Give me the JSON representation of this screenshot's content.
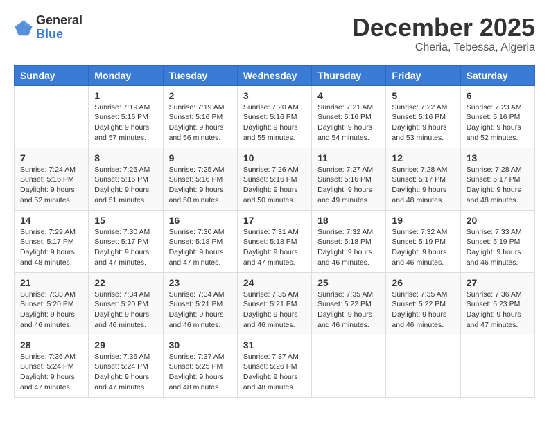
{
  "header": {
    "logo_general": "General",
    "logo_blue": "Blue",
    "month_title": "December 2025",
    "subtitle": "Cheria, Tebessa, Algeria"
  },
  "days_of_week": [
    "Sunday",
    "Monday",
    "Tuesday",
    "Wednesday",
    "Thursday",
    "Friday",
    "Saturday"
  ],
  "weeks": [
    [
      {
        "day": "",
        "info": ""
      },
      {
        "day": "1",
        "info": "Sunrise: 7:19 AM\nSunset: 5:16 PM\nDaylight: 9 hours\nand 57 minutes."
      },
      {
        "day": "2",
        "info": "Sunrise: 7:19 AM\nSunset: 5:16 PM\nDaylight: 9 hours\nand 56 minutes."
      },
      {
        "day": "3",
        "info": "Sunrise: 7:20 AM\nSunset: 5:16 PM\nDaylight: 9 hours\nand 55 minutes."
      },
      {
        "day": "4",
        "info": "Sunrise: 7:21 AM\nSunset: 5:16 PM\nDaylight: 9 hours\nand 54 minutes."
      },
      {
        "day": "5",
        "info": "Sunrise: 7:22 AM\nSunset: 5:16 PM\nDaylight: 9 hours\nand 53 minutes."
      },
      {
        "day": "6",
        "info": "Sunrise: 7:23 AM\nSunset: 5:16 PM\nDaylight: 9 hours\nand 52 minutes."
      }
    ],
    [
      {
        "day": "7",
        "info": "Sunrise: 7:24 AM\nSunset: 5:16 PM\nDaylight: 9 hours\nand 52 minutes."
      },
      {
        "day": "8",
        "info": "Sunrise: 7:25 AM\nSunset: 5:16 PM\nDaylight: 9 hours\nand 51 minutes."
      },
      {
        "day": "9",
        "info": "Sunrise: 7:25 AM\nSunset: 5:16 PM\nDaylight: 9 hours\nand 50 minutes."
      },
      {
        "day": "10",
        "info": "Sunrise: 7:26 AM\nSunset: 5:16 PM\nDaylight: 9 hours\nand 50 minutes."
      },
      {
        "day": "11",
        "info": "Sunrise: 7:27 AM\nSunset: 5:16 PM\nDaylight: 9 hours\nand 49 minutes."
      },
      {
        "day": "12",
        "info": "Sunrise: 7:28 AM\nSunset: 5:17 PM\nDaylight: 9 hours\nand 48 minutes."
      },
      {
        "day": "13",
        "info": "Sunrise: 7:28 AM\nSunset: 5:17 PM\nDaylight: 9 hours\nand 48 minutes."
      }
    ],
    [
      {
        "day": "14",
        "info": "Sunrise: 7:29 AM\nSunset: 5:17 PM\nDaylight: 9 hours\nand 48 minutes."
      },
      {
        "day": "15",
        "info": "Sunrise: 7:30 AM\nSunset: 5:17 PM\nDaylight: 9 hours\nand 47 minutes."
      },
      {
        "day": "16",
        "info": "Sunrise: 7:30 AM\nSunset: 5:18 PM\nDaylight: 9 hours\nand 47 minutes."
      },
      {
        "day": "17",
        "info": "Sunrise: 7:31 AM\nSunset: 5:18 PM\nDaylight: 9 hours\nand 47 minutes."
      },
      {
        "day": "18",
        "info": "Sunrise: 7:32 AM\nSunset: 5:18 PM\nDaylight: 9 hours\nand 46 minutes."
      },
      {
        "day": "19",
        "info": "Sunrise: 7:32 AM\nSunset: 5:19 PM\nDaylight: 9 hours\nand 46 minutes."
      },
      {
        "day": "20",
        "info": "Sunrise: 7:33 AM\nSunset: 5:19 PM\nDaylight: 9 hours\nand 46 minutes."
      }
    ],
    [
      {
        "day": "21",
        "info": "Sunrise: 7:33 AM\nSunset: 5:20 PM\nDaylight: 9 hours\nand 46 minutes."
      },
      {
        "day": "22",
        "info": "Sunrise: 7:34 AM\nSunset: 5:20 PM\nDaylight: 9 hours\nand 46 minutes."
      },
      {
        "day": "23",
        "info": "Sunrise: 7:34 AM\nSunset: 5:21 PM\nDaylight: 9 hours\nand 46 minutes."
      },
      {
        "day": "24",
        "info": "Sunrise: 7:35 AM\nSunset: 5:21 PM\nDaylight: 9 hours\nand 46 minutes."
      },
      {
        "day": "25",
        "info": "Sunrise: 7:35 AM\nSunset: 5:22 PM\nDaylight: 9 hours\nand 46 minutes."
      },
      {
        "day": "26",
        "info": "Sunrise: 7:35 AM\nSunset: 5:22 PM\nDaylight: 9 hours\nand 46 minutes."
      },
      {
        "day": "27",
        "info": "Sunrise: 7:36 AM\nSunset: 5:23 PM\nDaylight: 9 hours\nand 47 minutes."
      }
    ],
    [
      {
        "day": "28",
        "info": "Sunrise: 7:36 AM\nSunset: 5:24 PM\nDaylight: 9 hours\nand 47 minutes."
      },
      {
        "day": "29",
        "info": "Sunrise: 7:36 AM\nSunset: 5:24 PM\nDaylight: 9 hours\nand 47 minutes."
      },
      {
        "day": "30",
        "info": "Sunrise: 7:37 AM\nSunset: 5:25 PM\nDaylight: 9 hours\nand 48 minutes."
      },
      {
        "day": "31",
        "info": "Sunrise: 7:37 AM\nSunset: 5:26 PM\nDaylight: 9 hours\nand 48 minutes."
      },
      {
        "day": "",
        "info": ""
      },
      {
        "day": "",
        "info": ""
      },
      {
        "day": "",
        "info": ""
      }
    ]
  ]
}
